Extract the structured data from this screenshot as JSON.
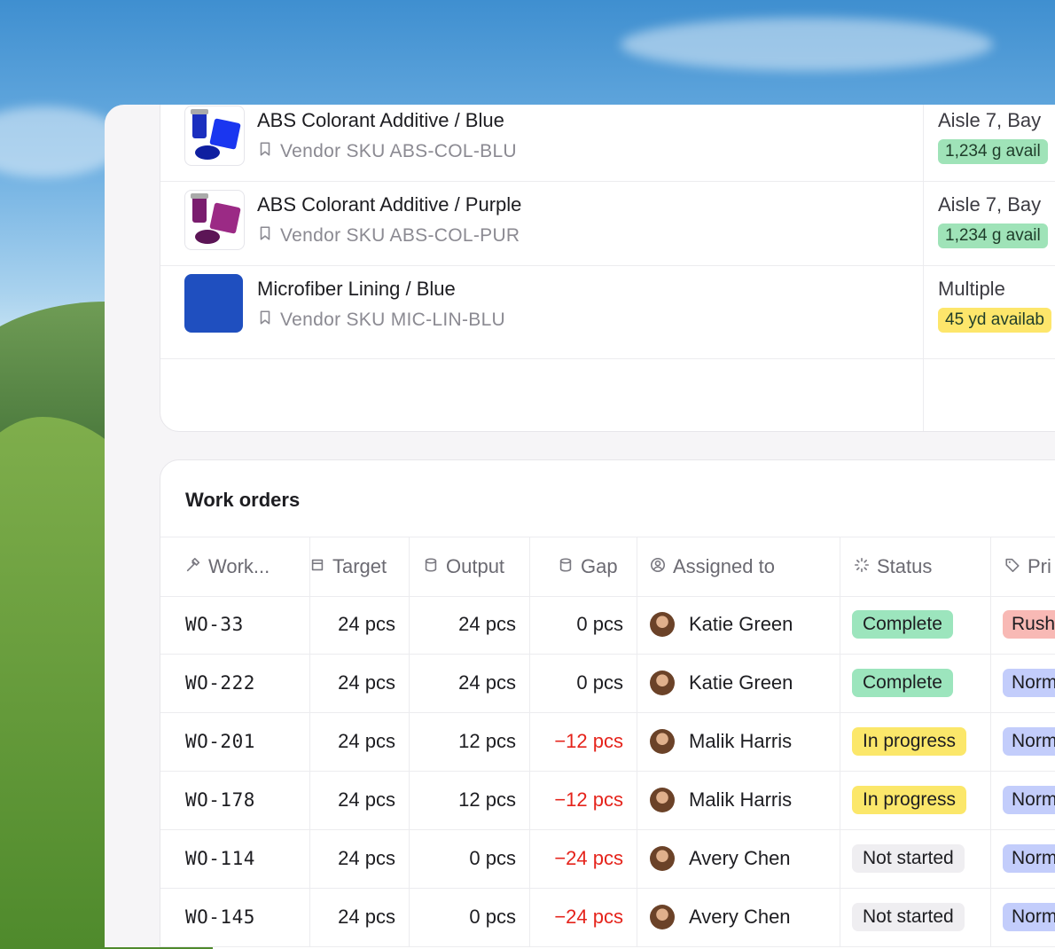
{
  "products": [
    {
      "name": "ABS Colorant Additive / Blue",
      "sku": "Vendor SKU ABS-COL-BLU",
      "location": "Aisle 7, Bay",
      "availability": "1,234 g avail",
      "avail_color": "#9fe3b8",
      "thumb": "blue-colorant"
    },
    {
      "name": "ABS Colorant Additive / Purple",
      "sku": "Vendor SKU ABS-COL-PUR",
      "location": "Aisle 7, Bay",
      "availability": "1,234 g avail",
      "avail_color": "#9fe3b8",
      "thumb": "purple-colorant"
    },
    {
      "name": "Microfiber Lining / Blue",
      "sku": "Vendor SKU MIC-LIN-BLU",
      "location": "Multiple",
      "availability": "45 yd availab",
      "avail_color": "#fde66b",
      "thumb": "blue-fabric"
    }
  ],
  "work_orders": {
    "title": "Work orders",
    "columns": [
      {
        "label": "Work...",
        "icon": "hammer-icon"
      },
      {
        "label": "Target",
        "icon": "box-icon"
      },
      {
        "label": "Output",
        "icon": "cylinder-icon"
      },
      {
        "label": "Gap",
        "icon": "cylinder-icon"
      },
      {
        "label": "Assigned to",
        "icon": "user-circle-icon"
      },
      {
        "label": "Status",
        "icon": "loader-icon"
      },
      {
        "label": "Pri",
        "icon": "tag-icon"
      }
    ],
    "rows": [
      {
        "id": "WO-33",
        "target": "24 pcs",
        "output": "24 pcs",
        "gap": "0 pcs",
        "assignee": "Katie Green",
        "status": "Complete",
        "priority": "Rush"
      },
      {
        "id": "WO-222",
        "target": "24 pcs",
        "output": "24 pcs",
        "gap": "0 pcs",
        "assignee": "Katie Green",
        "status": "Complete",
        "priority": "Norm"
      },
      {
        "id": "WO-201",
        "target": "24 pcs",
        "output": "12 pcs",
        "gap": "−12 pcs",
        "assignee": "Malik Harris",
        "status": "In progress",
        "priority": "Norm"
      },
      {
        "id": "WO-178",
        "target": "24 pcs",
        "output": "12 pcs",
        "gap": "−12 pcs",
        "assignee": "Malik Harris",
        "status": "In progress",
        "priority": "Norm"
      },
      {
        "id": "WO-114",
        "target": "24 pcs",
        "output": "0 pcs",
        "gap": "−24 pcs",
        "assignee": "Avery Chen",
        "status": "Not started",
        "priority": "Norm"
      },
      {
        "id": "WO-145",
        "target": "24 pcs",
        "output": "0 pcs",
        "gap": "−24 pcs",
        "assignee": "Avery Chen",
        "status": "Not started",
        "priority": "Norm"
      }
    ]
  },
  "colors": {
    "complete": "#9ce5bd",
    "in_progress": "#fbe76a",
    "not_started": "#efeef1",
    "rush": "#f8b9b5",
    "normal": "#c3cdfb",
    "negative": "#e5231b"
  }
}
